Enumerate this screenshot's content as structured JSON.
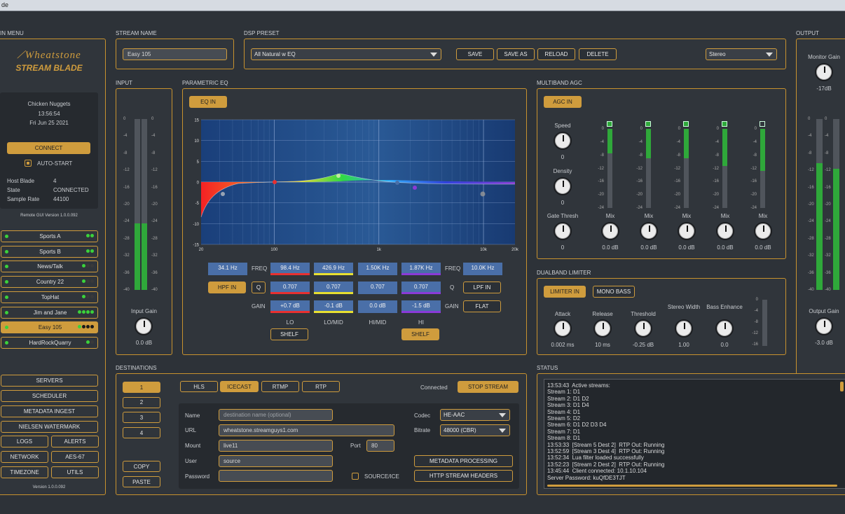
{
  "titlebar": {
    "text": "de"
  },
  "sections": {
    "main_menu": "IN MENU",
    "stream_name": "STREAM NAME",
    "dsp_preset": "DSP PRESET",
    "output": "OUTPUT",
    "input": "INPUT",
    "parametric_eq": "PARAMETRIC EQ",
    "multiband_agc": "MULTIBAND AGC",
    "dualband_limiter": "DUALBAND LIMITER",
    "destinations": "DESTINATIONS",
    "status": "STATUS"
  },
  "logo": {
    "brand": "Wheatstone",
    "product": "STREAM BLADE"
  },
  "info": {
    "now_playing": "Chicken Nuggets",
    "time": "13:56:54",
    "date": "Fri Jun 25 2021",
    "connect": "CONNECT",
    "auto_start": "AUTO-START",
    "host_blade_label": "Host Blade",
    "host_blade": "4",
    "state_label": "State",
    "state": "CONNECTED",
    "sample_rate_label": "Sample Rate",
    "sample_rate": "44100",
    "gui_version": "Remote GUI Version 1.0.0.092"
  },
  "channels": [
    {
      "name": "Sports A",
      "dots": "gg"
    },
    {
      "name": "Sports B",
      "dots": "gg"
    },
    {
      "name": "News/Talk",
      "dots": "gkk"
    },
    {
      "name": "Country 22",
      "dots": "gkk"
    },
    {
      "name": "TopHat",
      "dots": "gkk"
    },
    {
      "name": "Jim and Jane",
      "dots": "gggg"
    },
    {
      "name": "Easy 105",
      "dots": "gkkk"
    },
    {
      "name": "HardRockQuarry",
      "dots": "gk"
    }
  ],
  "nav": {
    "servers": "SERVERS",
    "scheduler": "SCHEDULER",
    "metadata_ingest": "METADATA INGEST",
    "nielsen": "NIELSEN WATERMARK",
    "logs": "LOGS",
    "alerts": "ALERTS",
    "network": "NETWORK",
    "aes67": "AES-67",
    "timezone": "TIMEZONE",
    "utils": "UTILS",
    "version": "Version 1.0.0.092"
  },
  "stream_name": {
    "value": "Easy 105"
  },
  "dsp": {
    "preset": "All Natural w EQ",
    "save": "SAVE",
    "save_as": "SAVE AS",
    "reload": "RELOAD",
    "delete": "DELETE",
    "mode": "Stereo"
  },
  "output": {
    "monitor_gain_label": "Monitor Gain",
    "monitor_gain": "-17dB",
    "output_gain_label": "Output Gain",
    "output_gain": "-3.0 dB",
    "level_left": 0.74,
    "level_right": 0.71
  },
  "input": {
    "gain_label": "Input Gain",
    "gain": "0.0 dB",
    "level_left": 0.39,
    "level_right": 0.39
  },
  "meter_ticks": [
    "0",
    "-4",
    "-8",
    "-12",
    "-16",
    "-20",
    "-24",
    "-28",
    "-32",
    "-36",
    "-40"
  ],
  "eq": {
    "eq_in": "EQ IN",
    "y_ticks": [
      "15",
      "10",
      "5",
      "0",
      "-5",
      "-10",
      "-15"
    ],
    "x_ticks": [
      "20",
      "100",
      "1k",
      "10k",
      "20k"
    ],
    "hpf_freq": "34.1 Hz",
    "hpf_in": "HPF IN",
    "q_label": "Q",
    "freq_label": "FREQ",
    "gain_label": "GAIN",
    "bands": [
      {
        "name": "LO",
        "freq": "98.4 Hz",
        "q": "0.707",
        "gain": "+0.7 dB",
        "color": "#e83030"
      },
      {
        "name": "LO/MID",
        "freq": "426.9 Hz",
        "q": "0.707",
        "gain": "-0.1 dB",
        "color": "#e8e030"
      },
      {
        "name": "HI/MID",
        "freq": "1.50K Hz",
        "q": "0.707",
        "gain": "0.0 dB",
        "color": "#4a6fa8"
      },
      {
        "name": "HI",
        "freq": "1.87K Hz",
        "q": "0.707",
        "gain": "-1.5 dB",
        "color": "#8a3ad8"
      }
    ],
    "shelf": "SHELF",
    "lpf_freq": "10.0K Hz",
    "lpf_in": "LPF IN",
    "flat": "FLAT"
  },
  "agc": {
    "agc_in": "AGC IN",
    "speed_label": "Speed",
    "speed": "0",
    "density_label": "Density",
    "density": "0",
    "gate_label": "Gate Thresh",
    "gate": "0",
    "band_ticks": [
      "0",
      "-4",
      "-8",
      "-12",
      "-16",
      "-20",
      "-24"
    ],
    "bands": [
      {
        "mix": "0.0 dB",
        "level": 0.47
      },
      {
        "mix": "0.0 dB",
        "level": 0.6
      },
      {
        "mix": "0.0 dB",
        "level": 0.6
      },
      {
        "mix": "0.0 dB",
        "level": 0.8
      },
      {
        "mix": "0.0 dB",
        "level": 0.92
      }
    ],
    "mix_label": "Mix"
  },
  "limiter": {
    "limiter_in": "LIMITER IN",
    "mono_bass": "MONO BASS",
    "attack_label": "Attack",
    "attack": "0.002 ms",
    "release_label": "Release",
    "release": "10 ms",
    "threshold_label": "Threshold",
    "threshold": "-0.25 dB",
    "stereo_width_label": "Stereo Width",
    "stereo_width": "1.00",
    "bass_enhance_label": "Bass Enhance",
    "bass_enhance": "0.0",
    "ticks": [
      "0",
      "-4",
      "-8",
      "-12",
      "-16"
    ]
  },
  "destinations": {
    "slots": [
      "1",
      "2",
      "3",
      "4"
    ],
    "copy": "COPY",
    "paste": "PASTE",
    "protocols": [
      "HLS",
      "ICECAST",
      "RTMP",
      "RTP"
    ],
    "connected": "Connected",
    "stop_stream": "STOP STREAM",
    "name_label": "Name",
    "name_placeholder": "destination name (optional)",
    "url_label": "URL",
    "url": "wheatstone.streamguys1.com",
    "mount_label": "Mount",
    "mount": "live11",
    "port_label": "Port",
    "port": "80",
    "user_label": "User",
    "user": "source",
    "password_label": "Password",
    "source_ice": "SOURCE/ICE",
    "codec_label": "Codec",
    "codec": "HE-AAC",
    "bitrate_label": "Bitrate",
    "bitrate": "48000  (CBR)",
    "metadata_processing": "METADATA PROCESSING",
    "http_headers": "HTTP STREAM HEADERS"
  },
  "status": {
    "lines": [
      "13:53:43  Active streams:",
      "Stream 1: D1",
      "Stream 2: D1 D2",
      "Stream 3: D1 D4",
      "Stream 4: D1",
      "Stream 5: D2",
      "Stream 6: D1 D2 D3 D4",
      "Stream 7: D1",
      "Stream 8: D1",
      "13:53:33  [Stream 5 Dest 2]  RTP Out: Running",
      "13:52:59  [Stream 3 Dest 4]  RTP Out: Running",
      "13:52:34  Lua filter loaded successfully",
      "13:52:23  [Stream 2 Dest 2]  RTP Out: Running",
      "13:45:44  Client connected: 10.1.10.104",
      "Server Password: kuQfDE3TJT"
    ]
  }
}
